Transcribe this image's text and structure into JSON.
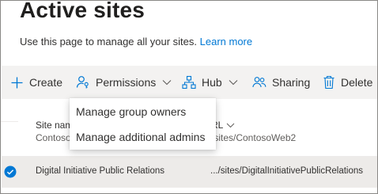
{
  "page": {
    "title": "Active sites",
    "description": "Use this page to manage all your sites.",
    "learn_more": "Learn more"
  },
  "commandbar": {
    "create": "Create",
    "permissions": "Permissions",
    "hub": "Hub",
    "sharing": "Sharing",
    "delete": "Delete"
  },
  "permissions_menu": {
    "items": [
      "Manage group owners",
      "Manage additional admins"
    ]
  },
  "table": {
    "columns": {
      "site_name": "Site nam",
      "url": "RL"
    },
    "rows": [
      {
        "site_name": "Contoso",
        "url": "/sites/ContosoWeb2",
        "selected": false
      },
      {
        "site_name": "Digital Initiative Public Relations",
        "url": ".../sites/DigitalInitiativePublicRelations",
        "selected": true
      }
    ]
  },
  "colors": {
    "accent": "#0078d4",
    "commandbar_bg": "#f3f2f1",
    "selected_row_bg": "#edebe9"
  }
}
